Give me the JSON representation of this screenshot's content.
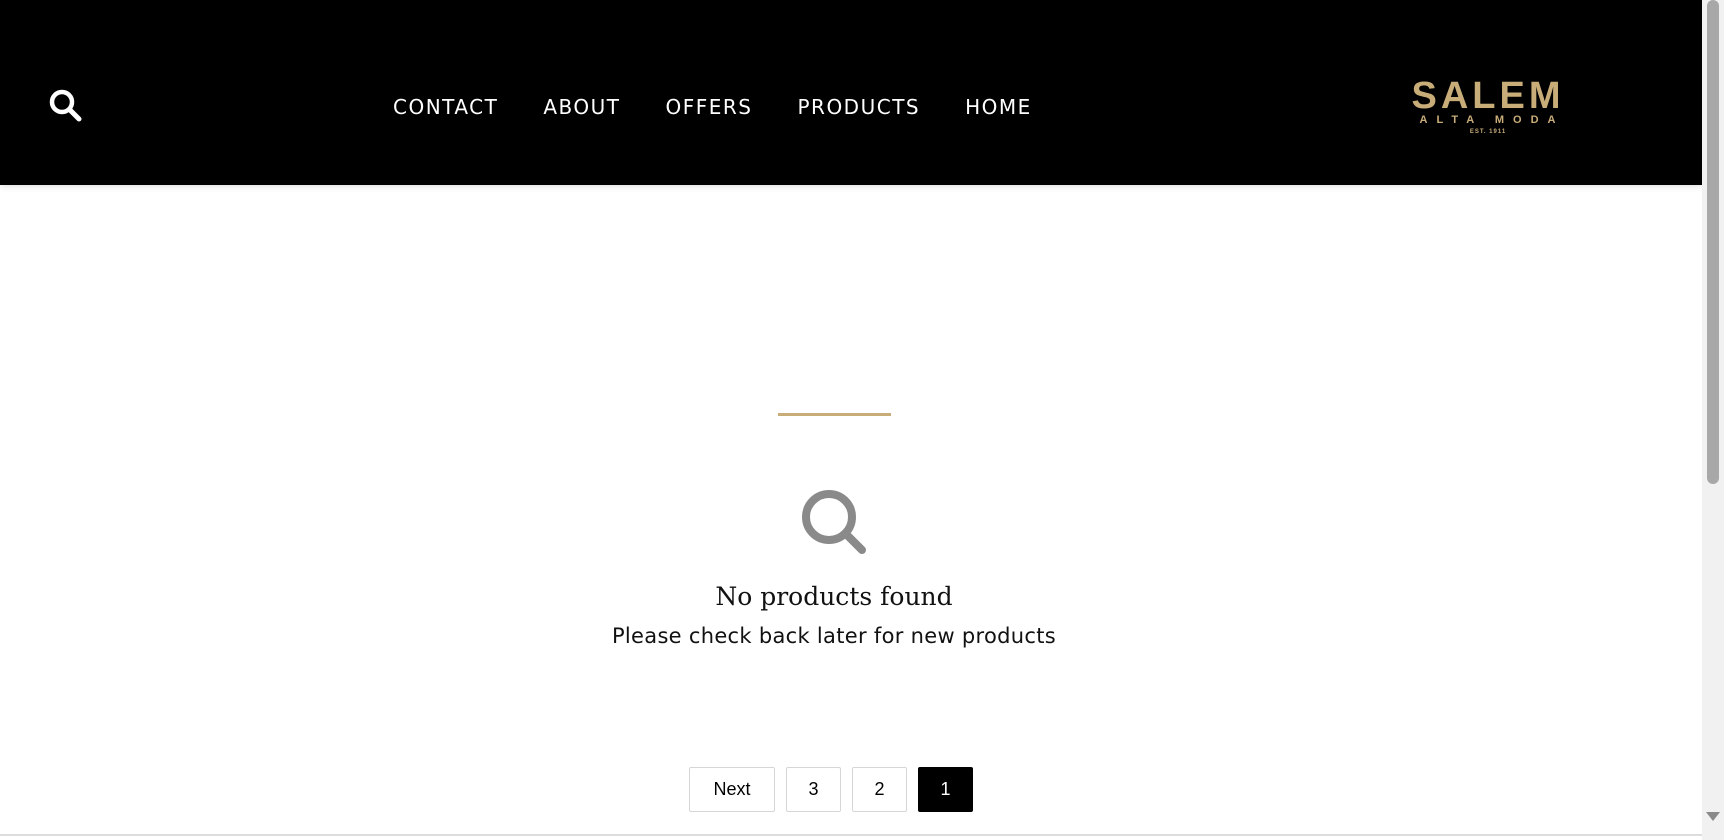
{
  "header": {
    "search_icon": "search-icon",
    "nav": [
      {
        "label": "CONTACT"
      },
      {
        "label": "ABOUT"
      },
      {
        "label": "OFFERS"
      },
      {
        "label": "PRODUCTS"
      },
      {
        "label": "HOME"
      }
    ],
    "logo": {
      "main": "SALEM",
      "sub": "ALTA MODA",
      "est": "EST. 1911"
    }
  },
  "main": {
    "empty_icon": "search-icon",
    "empty_title": "No products found",
    "empty_message": "Please check back later for new products"
  },
  "pagination": {
    "next_label": "Next",
    "pages": [
      "3",
      "2",
      "1"
    ],
    "current_page": "1"
  },
  "colors": {
    "header_bg": "#000000",
    "accent_gold": "#c9ad78",
    "empty_icon": "#8a8a8a",
    "active_page_bg": "#000000"
  }
}
